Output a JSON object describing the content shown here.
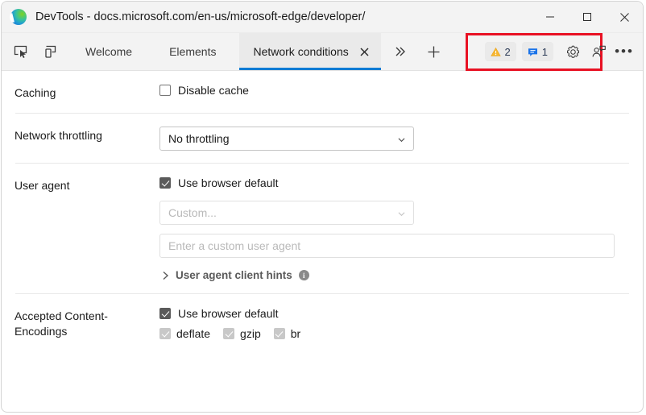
{
  "window": {
    "title": "DevTools - docs.microsoft.com/en-us/microsoft-edge/developer/",
    "logo_icon": "edge-logo-icon",
    "controls": {
      "minimize": "minimize-icon",
      "maximize": "maximize-icon",
      "close": "close-icon"
    }
  },
  "tabbar": {
    "inspect_icon": "inspect-element-icon",
    "device_icon": "device-emulation-icon",
    "tabs": [
      {
        "label": "Welcome",
        "active": false
      },
      {
        "label": "Elements",
        "active": false
      },
      {
        "label": "Network conditions",
        "active": true
      }
    ],
    "close_tab_icon": "close-icon",
    "more_tabs_icon": "chevron-double-right-icon",
    "add_tab_icon": "plus-icon",
    "warnings": {
      "icon": "warning-triangle-icon",
      "count": "2"
    },
    "issues": {
      "icon": "issue-message-icon",
      "count": "1"
    },
    "settings_icon": "gear-icon",
    "feedback_icon": "feedback-icon",
    "more_options_icon": "ellipsis-icon",
    "highlight_color": "#e81123",
    "active_tab_underline_color": "#0f7bd4"
  },
  "panel": {
    "caching": {
      "label": "Caching",
      "disable_cache": {
        "label": "Disable cache",
        "checked": false
      }
    },
    "throttling": {
      "label": "Network throttling",
      "selected": "No throttling",
      "chevron_icon": "chevron-down-icon"
    },
    "user_agent": {
      "label": "User agent",
      "use_browser_default": {
        "label": "Use browser default",
        "checked": true
      },
      "custom_select": {
        "value": "Custom...",
        "disabled": true,
        "chevron_icon": "chevron-down-icon"
      },
      "custom_input": {
        "placeholder": "Enter a custom user agent",
        "value": ""
      },
      "client_hints": {
        "label": "User agent client hints",
        "expanded": false,
        "caret_icon": "chevron-right-icon",
        "info_icon": "info-icon",
        "info_glyph": "i"
      }
    },
    "encodings": {
      "label": "Accepted Content-Encodings",
      "use_browser_default": {
        "label": "Use browser default",
        "checked": true
      },
      "items": [
        {
          "label": "deflate",
          "checked": true,
          "disabled": true
        },
        {
          "label": "gzip",
          "checked": true,
          "disabled": true
        },
        {
          "label": "br",
          "checked": true,
          "disabled": true
        }
      ]
    }
  }
}
